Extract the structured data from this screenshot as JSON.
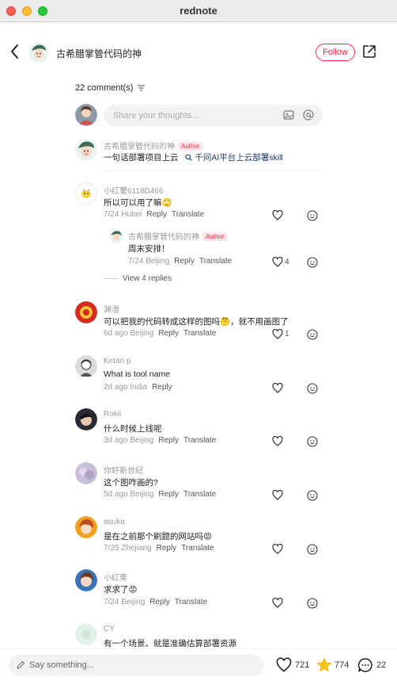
{
  "window": {
    "title": "rednote"
  },
  "header": {
    "author_name": "古希腊掌管代码的神",
    "follow_label": "Follow"
  },
  "comments_summary": {
    "count_label": "22 comment(s)"
  },
  "composer": {
    "placeholder": "Share your thoughts..."
  },
  "pinned": {
    "name": "古希腊掌管代码的神",
    "badge": "Author",
    "text": "一句话部署项目上云",
    "link_text": "千问AI平台上云部署skill"
  },
  "comments": [
    {
      "name": "小红薯6118D466",
      "text": "所以可以用了嘛🙄",
      "meta": "7/24 Hubei",
      "reply": "Reply",
      "translate": "Translate",
      "likes": ""
    },
    {
      "name": "古希腊掌管代码的神",
      "badge": "Author",
      "text": "周末安排！",
      "meta": "7/24 Beijing",
      "reply": "Reply",
      "translate": "Translate",
      "likes": "4"
    },
    {
      "name": "渊澄",
      "text": "可以把我的代码转成这样的图吗🤔，就不用画图了",
      "meta": "6d ago Beijing",
      "reply": "Reply",
      "translate": "Translate",
      "likes": "1"
    },
    {
      "name": "Ketan p",
      "text": "What is tool name",
      "meta": "2d ago India",
      "reply": "Reply",
      "translate": "",
      "likes": ""
    },
    {
      "name": "Rokii",
      "text": "什么时候上线呢",
      "meta": "3d ago Beijing",
      "reply": "Reply",
      "translate": "Translate",
      "likes": ""
    },
    {
      "name": "你好新世纪",
      "text": "这个图咋画的?",
      "meta": "5d ago Beijing",
      "reply": "Reply",
      "translate": "Translate",
      "likes": ""
    },
    {
      "name": "asuka",
      "text": "是在之前那个刷题的网站吗😡",
      "meta": "7/25 Zhejiang",
      "reply": "Reply",
      "translate": "Translate",
      "likes": ""
    },
    {
      "name": "小红栗",
      "text": "求求了😡",
      "meta": "7/24 Beijing",
      "reply": "Reply",
      "translate": "Translate",
      "likes": ""
    },
    {
      "name": "CY",
      "text": "有一个场景。就是准确估算部署资源",
      "meta": "",
      "reply": "",
      "translate": "",
      "likes": ""
    }
  ],
  "view_replies": "View 4 replies",
  "bottom": {
    "say_placeholder": "Say something...",
    "likes": "721",
    "stars": "774",
    "comments": "22"
  },
  "colors": {
    "accent": "#ff2442",
    "link": "#13386c",
    "star": "#f5c518"
  },
  "icons": [
    "back-icon",
    "share-icon",
    "sort-icon",
    "image-icon",
    "at-icon",
    "search-icon",
    "heart-icon",
    "smile-icon",
    "pencil-icon",
    "star-icon",
    "comment-icon"
  ]
}
